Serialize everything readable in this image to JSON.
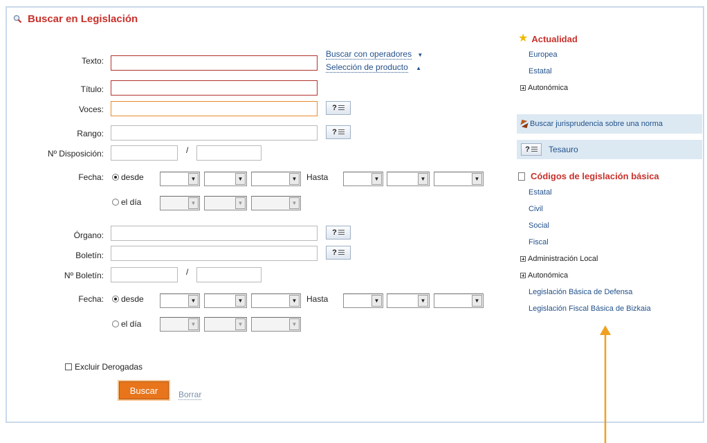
{
  "header": {
    "title": "Buscar en Legislación",
    "icon": "search-icon"
  },
  "links": {
    "operadores": "Buscar con operadores",
    "producto": "Selección de producto"
  },
  "form": {
    "texto": "Texto:",
    "titulo": "Título:",
    "voces": "Voces:",
    "rango": "Rango:",
    "disposicion": "Nº Disposición:",
    "fecha1": "Fecha:",
    "organo": "Órgano:",
    "boletin": "Boletín:",
    "nboletin": "Nº Boletín:",
    "fecha2": "Fecha:",
    "slash": "/",
    "desde": "desde",
    "hasta": "Hasta",
    "eldia": "el día",
    "help_label": "?"
  },
  "excluir": "Excluir Derogadas",
  "buttons": {
    "buscar": "Buscar",
    "borrar": "Borrar"
  },
  "sidebar": {
    "actualidad": {
      "title": "Actualidad",
      "items": [
        "Europea",
        "Estatal",
        "Autonómica"
      ]
    },
    "jurisprudencia": "Buscar jurisprudencia sobre una norma",
    "tesauro": "Tesauro",
    "codigos": {
      "title": "Códigos de legislación básica",
      "items": [
        "Estatal",
        "Civil",
        "Social",
        "Fiscal",
        "Administración Local",
        "Autonómica",
        "Legislación Básica de Defensa",
        "Legislación Fiscal Básica de Bizkaia"
      ]
    }
  },
  "colors": {
    "accent": "#c8312b",
    "link": "#23518a",
    "button": "#e8751b",
    "arrow": "#f0a020"
  }
}
